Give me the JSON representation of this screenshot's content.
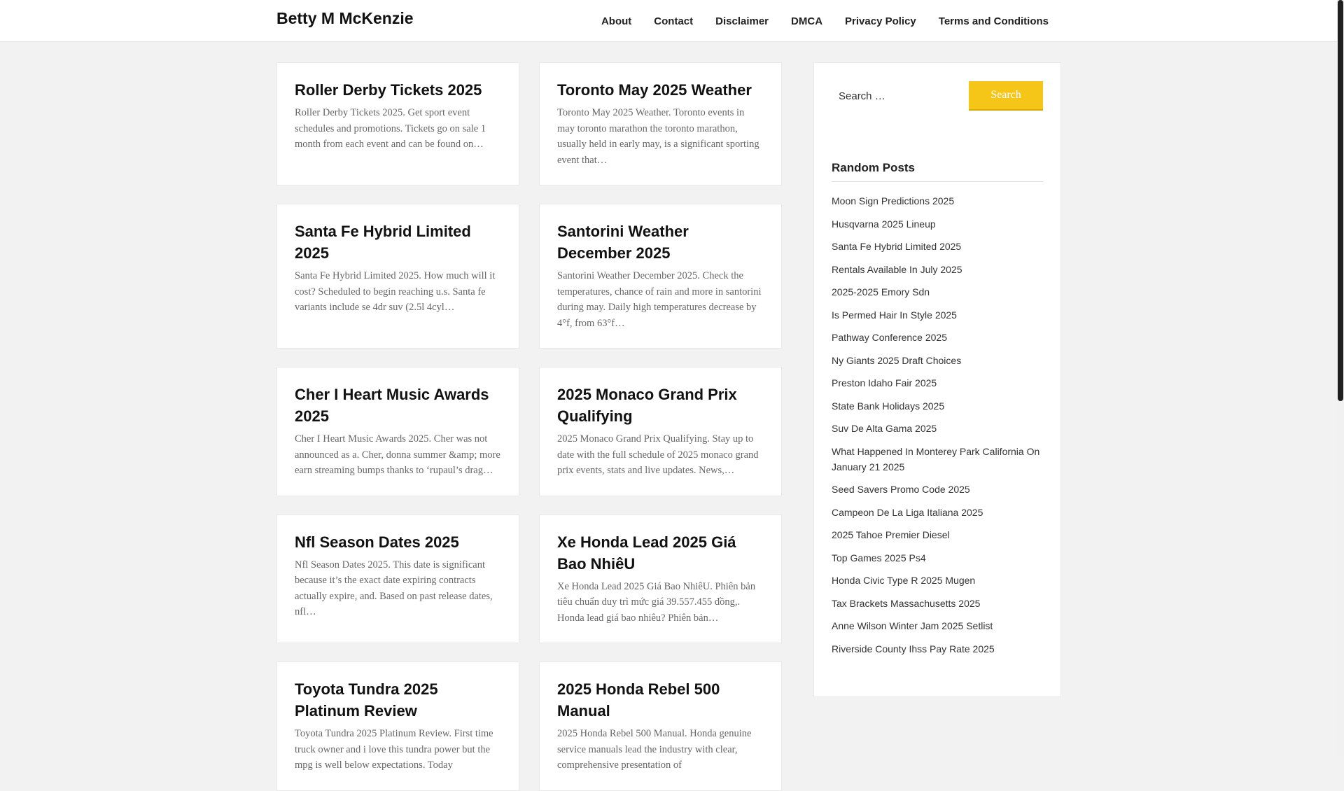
{
  "site": {
    "title": "Betty M McKenzie"
  },
  "nav": {
    "items": [
      "About",
      "Contact",
      "Disclaimer",
      "DMCA",
      "Privacy Policy",
      "Terms and Conditions"
    ]
  },
  "posts": [
    {
      "title": "Roller Derby Tickets 2025",
      "excerpt": "Roller Derby Tickets 2025. Get sport event schedules and promotions. Tickets go on sale 1 month from each event and can be found on…"
    },
    {
      "title": "Toronto May 2025 Weather",
      "excerpt": "Toronto May 2025 Weather. Toronto events in may toronto marathon the toronto marathon, usually held in early may, is a significant sporting event that…"
    },
    {
      "title": "Santa Fe Hybrid Limited 2025",
      "excerpt": "Santa Fe Hybrid Limited 2025. How much will it cost? Scheduled to begin reaching u.s. Santa fe variants include se 4dr suv (2.5l 4cyl…"
    },
    {
      "title": "Santorini Weather December 2025",
      "excerpt": "Santorini Weather December 2025. Check the temperatures, chance of rain and more in santorini during may. Daily high temperatures decrease by 4°f, from 63°f…"
    },
    {
      "title": "Cher I Heart Music Awards 2025",
      "excerpt": "Cher I Heart Music Awards 2025. Cher was not announced as a. Cher, donna summer &amp; more earn streaming bumps thanks to ‘rupaul’s drag…"
    },
    {
      "title": "2025 Monaco Grand Prix Qualifying",
      "excerpt": "2025 Monaco Grand Prix Qualifying. Stay up to date with the full schedule of 2025 monaco grand prix events, stats and live updates. News,…"
    },
    {
      "title": "Nfl Season Dates 2025",
      "excerpt": "Nfl Season Dates 2025. This date is significant because it’s the exact date expiring contracts actually expire, and. Based on past release dates, nfl…"
    },
    {
      "title": "Xe Honda Lead 2025 Giá Bao NhiêU",
      "excerpt": "Xe Honda Lead 2025 Giá Bao NhiêU. Phiên bản tiêu chuẩn duy trì mức giá 39.557.455 đồng,. Honda lead giá bao nhiêu? Phiên bản…"
    },
    {
      "title": "Toyota Tundra 2025 Platinum Review",
      "excerpt": "Toyota Tundra 2025 Platinum Review. First time truck owner and i love this tundra power but the mpg is well below expectations. Today"
    },
    {
      "title": "2025 Honda Rebel 500 Manual",
      "excerpt": "2025 Honda Rebel 500 Manual. Honda genuine service manuals lead the industry with clear, comprehensive presentation of"
    }
  ],
  "sidebar": {
    "search_placeholder": "Search …",
    "search_button": "Search",
    "random_posts_title": "Random Posts",
    "random_posts": [
      "Moon Sign Predictions 2025",
      "Husqvarna 2025 Lineup",
      "Santa Fe Hybrid Limited 2025",
      "Rentals Available In July 2025",
      "2025-2025 Emory Sdn",
      "Is Permed Hair In Style 2025",
      "Pathway Conference 2025",
      "Ny Giants 2025 Draft Choices",
      "Preston Idaho Fair 2025",
      "State Bank Holidays 2025",
      "Suv De Alta Gama 2025",
      "What Happened In Monterey Park California On January 21 2025",
      "Seed Savers Promo Code 2025",
      "Campeon De La Liga Italiana 2025",
      "2025 Tahoe Premier Diesel",
      "Top Games 2025 Ps4",
      "Honda Civic Type R 2025 Mugen",
      "Tax Brackets Massachusetts 2025",
      "Anne Wilson Winter Jam 2025 Setlist",
      "Riverside County Ihss Pay Rate 2025"
    ]
  },
  "colors": {
    "accent": "#f5c518",
    "page_background": "#f2f2f2",
    "card_background": "#ffffff"
  }
}
